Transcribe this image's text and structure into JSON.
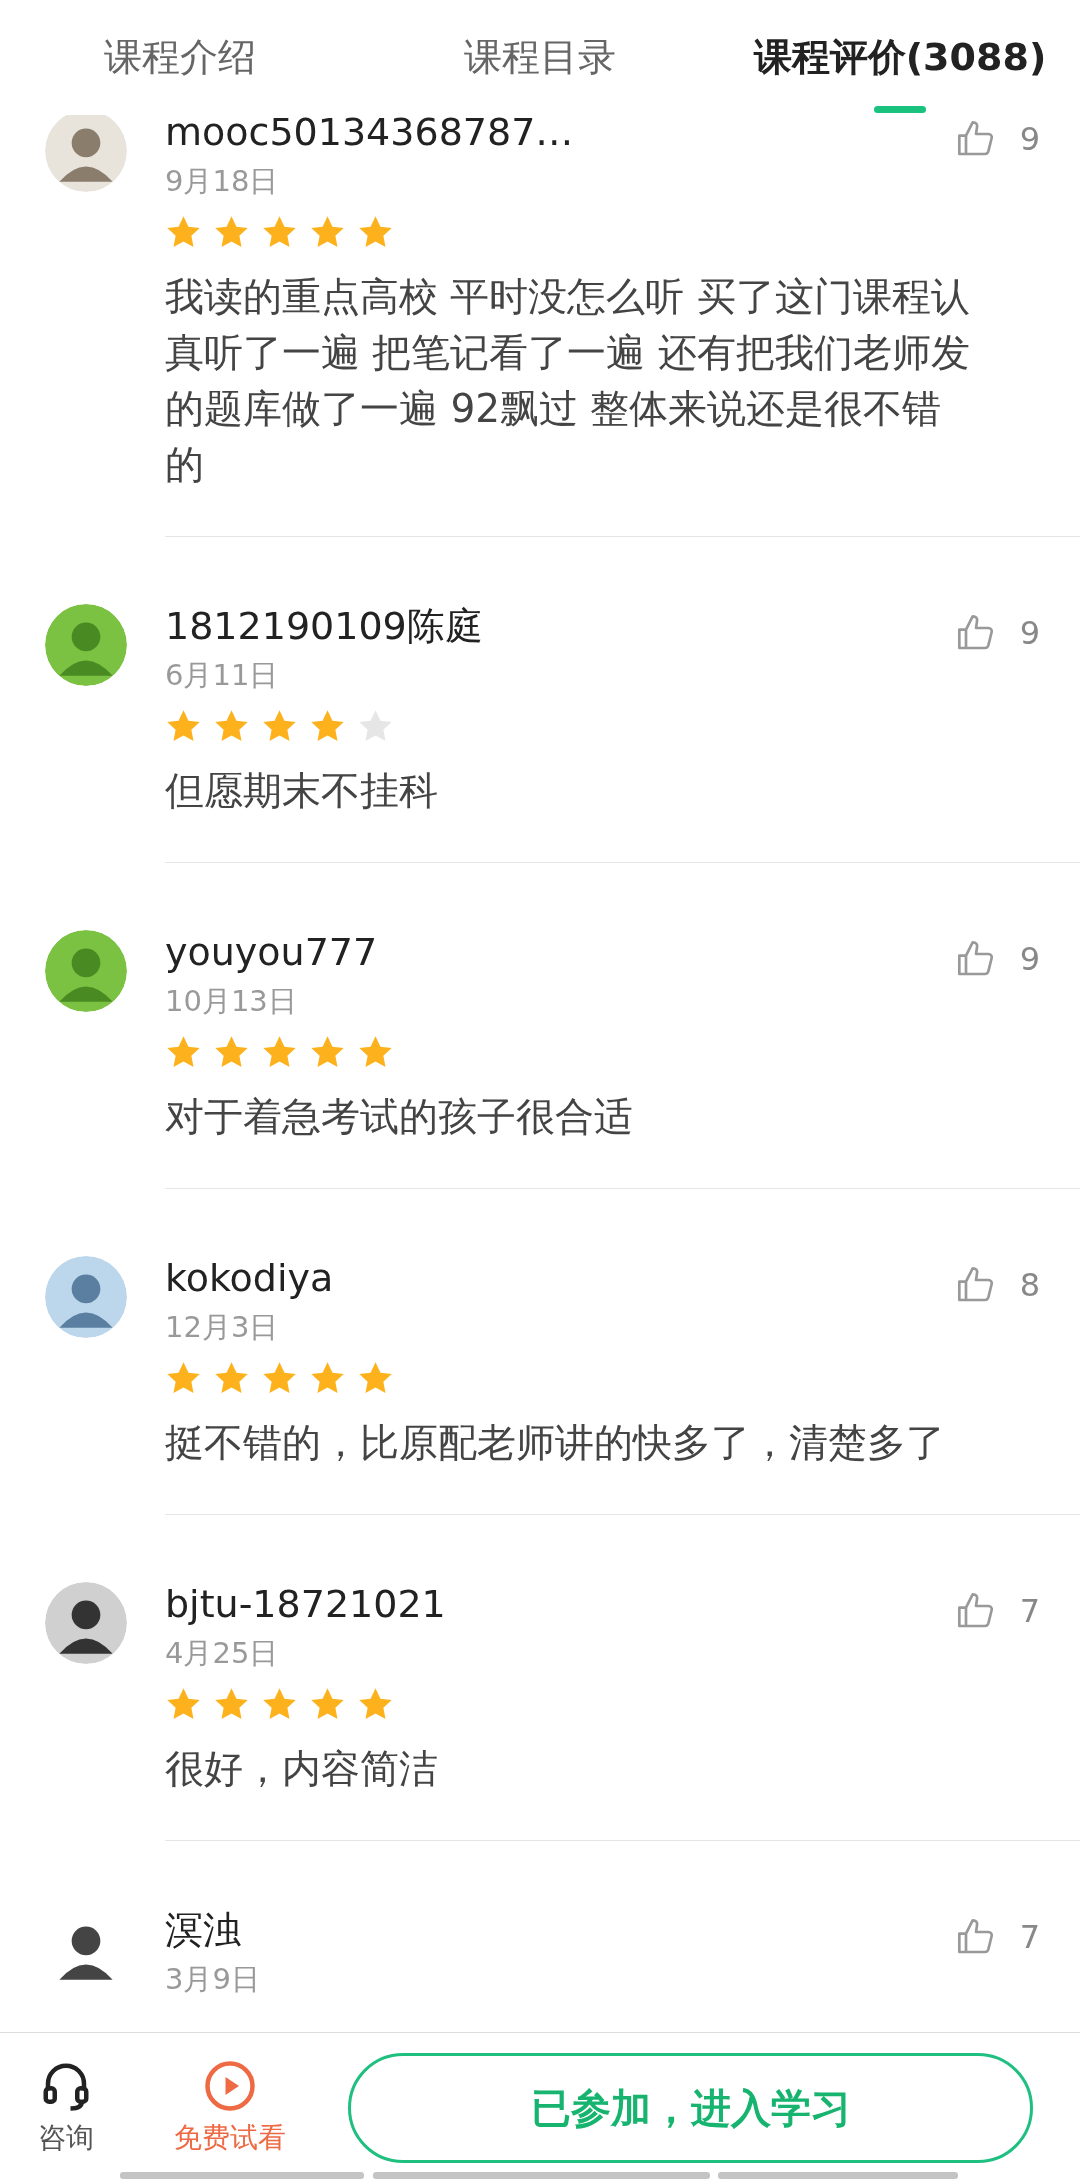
{
  "tabs": [
    {
      "label": "课程介绍",
      "selected": false
    },
    {
      "label": "课程目录",
      "selected": false
    },
    {
      "label": "课程评价(3088)",
      "selected": true
    }
  ],
  "reviews": [
    {
      "user": "mooc50134368787…",
      "date": "9月18日",
      "stars": 5,
      "likes": "9",
      "content": "我读的重点高校 平时没怎么听 买了这门课程认真听了一遍 把笔记看了一遍 还有把我们老师发的题库做了一遍 92飘过 整体来说还是很不错的"
    },
    {
      "user": "1812190109陈庭",
      "date": "6月11日",
      "stars": 4,
      "likes": "9",
      "content": "但愿期末不挂科"
    },
    {
      "user": "youyou777",
      "date": "10月13日",
      "stars": 5,
      "likes": "9",
      "content": "对于着急考试的孩子很合适"
    },
    {
      "user": "kokodiya",
      "date": "12月3日",
      "stars": 5,
      "likes": "8",
      "content": "挺不错的，比原配老师讲的快多了，清楚多了"
    },
    {
      "user": "bjtu-18721021",
      "date": "4月25日",
      "stars": 5,
      "likes": "7",
      "content": "很好，内容简洁"
    },
    {
      "user": "溟浊",
      "date": "3月9日",
      "likes": "7"
    }
  ],
  "bottom_bar": {
    "consult": "咨询",
    "trial": "免费试看",
    "join_button": "已参加，进入学习"
  }
}
